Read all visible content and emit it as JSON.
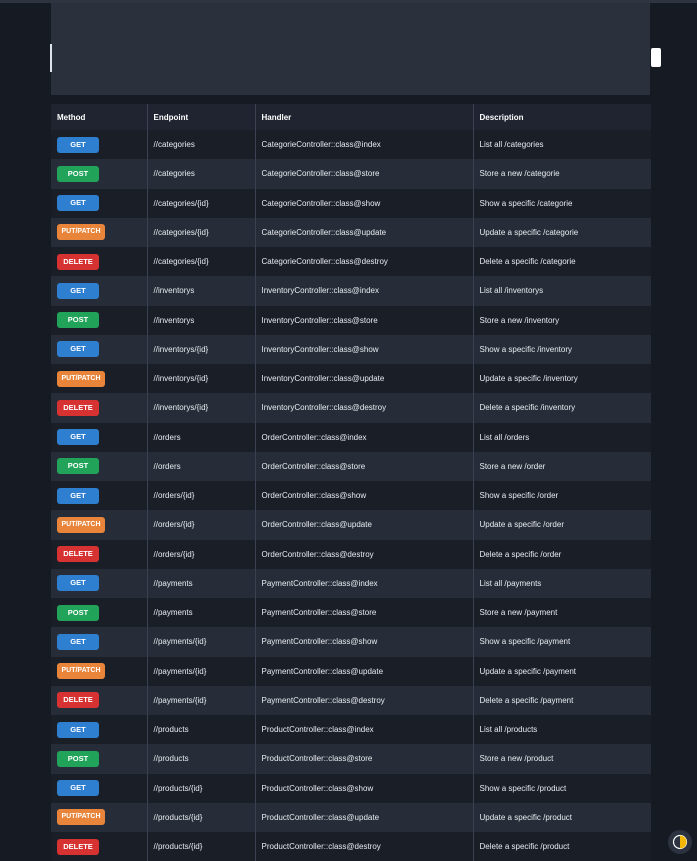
{
  "table": {
    "headers": [
      "Method",
      "Endpoint",
      "Handler",
      "Description"
    ],
    "rows": [
      {
        "method": "GET",
        "endpoint": "//categories",
        "handler": "CategorieController::class@index",
        "description": "List all /categories"
      },
      {
        "method": "POST",
        "endpoint": "//categories",
        "handler": "CategorieController::class@store",
        "description": "Store a new /categorie"
      },
      {
        "method": "GET",
        "endpoint": "//categories/{id}",
        "handler": "CategorieController::class@show",
        "description": "Show a specific /categorie"
      },
      {
        "method": "PUT/PATCH",
        "endpoint": "//categories/{id}",
        "handler": "CategorieController::class@update",
        "description": "Update a specific /categorie"
      },
      {
        "method": "DELETE",
        "endpoint": "//categories/{id}",
        "handler": "CategorieController::class@destroy",
        "description": "Delete a specific /categorie"
      },
      {
        "method": "GET",
        "endpoint": "//inventorys",
        "handler": "InventoryController::class@index",
        "description": "List all /inventorys"
      },
      {
        "method": "POST",
        "endpoint": "//inventorys",
        "handler": "InventoryController::class@store",
        "description": "Store a new /inventory"
      },
      {
        "method": "GET",
        "endpoint": "//inventorys/{id}",
        "handler": "InventoryController::class@show",
        "description": "Show a specific /inventory"
      },
      {
        "method": "PUT/PATCH",
        "endpoint": "//inventorys/{id}",
        "handler": "InventoryController::class@update",
        "description": "Update a specific /inventory"
      },
      {
        "method": "DELETE",
        "endpoint": "//inventorys/{id}",
        "handler": "InventoryController::class@destroy",
        "description": "Delete a specific /inventory"
      },
      {
        "method": "GET",
        "endpoint": "//orders",
        "handler": "OrderController::class@index",
        "description": "List all /orders"
      },
      {
        "method": "POST",
        "endpoint": "//orders",
        "handler": "OrderController::class@store",
        "description": "Store a new /order"
      },
      {
        "method": "GET",
        "endpoint": "//orders/{id}",
        "handler": "OrderController::class@show",
        "description": "Show a specific /order"
      },
      {
        "method": "PUT/PATCH",
        "endpoint": "//orders/{id}",
        "handler": "OrderController::class@update",
        "description": "Update a specific /order"
      },
      {
        "method": "DELETE",
        "endpoint": "//orders/{id}",
        "handler": "OrderController::class@destroy",
        "description": "Delete a specific /order"
      },
      {
        "method": "GET",
        "endpoint": "//payments",
        "handler": "PaymentController::class@index",
        "description": "List all /payments"
      },
      {
        "method": "POST",
        "endpoint": "//payments",
        "handler": "PaymentController::class@store",
        "description": "Store a new /payment"
      },
      {
        "method": "GET",
        "endpoint": "//payments/{id}",
        "handler": "PaymentController::class@show",
        "description": "Show a specific /payment"
      },
      {
        "method": "PUT/PATCH",
        "endpoint": "//payments/{id}",
        "handler": "PaymentController::class@update",
        "description": "Update a specific /payment"
      },
      {
        "method": "DELETE",
        "endpoint": "//payments/{id}",
        "handler": "PaymentController::class@destroy",
        "description": "Delete a specific /payment"
      },
      {
        "method": "GET",
        "endpoint": "//products",
        "handler": "ProductController::class@index",
        "description": "List all /products"
      },
      {
        "method": "POST",
        "endpoint": "//products",
        "handler": "ProductController::class@store",
        "description": "Store a new /product"
      },
      {
        "method": "GET",
        "endpoint": "//products/{id}",
        "handler": "ProductController::class@show",
        "description": "Show a specific /product"
      },
      {
        "method": "PUT/PATCH",
        "endpoint": "//products/{id}",
        "handler": "ProductController::class@update",
        "description": "Update a specific /product"
      },
      {
        "method": "DELETE",
        "endpoint": "//products/{id}",
        "handler": "ProductController::class@destroy",
        "description": "Delete a specific /product"
      }
    ]
  },
  "method_colors": {
    "GET": "#2f7fd0",
    "POST": "#22a35a",
    "PUT/PATCH": "#e8853a",
    "DELETE": "#d63232"
  },
  "theme_toggle": {
    "icon": "half-moon-icon",
    "color": "#f2b705"
  }
}
